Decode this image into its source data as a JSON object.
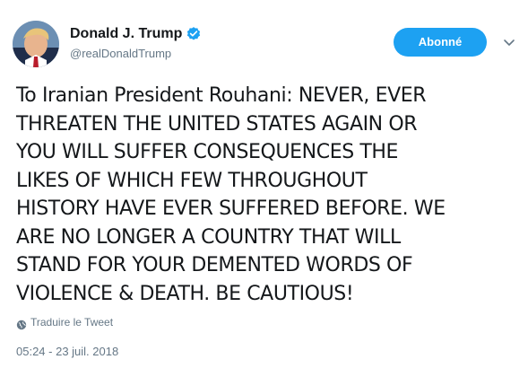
{
  "user": {
    "display_name": "Donald J. Trump",
    "handle": "@realDonaldTrump",
    "verified": true
  },
  "header": {
    "follow_label": "Abonné"
  },
  "tweet": {
    "text": "To Iranian President Rouhani: NEVER, EVER\nTHREATEN THE UNITED STATES AGAIN OR\nYOU WILL SUFFER CONSEQUENCES THE\nLIKES OF WHICH FEW THROUGHOUT\nHISTORY HAVE EVER SUFFERED BEFORE. WE\nARE NO LONGER A COUNTRY THAT WILL\nSTAND FOR YOUR DEMENTED WORDS OF\nVIOLENCE & DEATH. BE CAUTIOUS!",
    "translate_label": "Traduire le Tweet",
    "timestamp": "05:24 - 23 juil. 2018"
  },
  "icons": {
    "verified": "verified-badge-icon",
    "menu": "chevron-down-icon",
    "translate": "globe-icon"
  },
  "colors": {
    "accent": "#1da1f2",
    "text_primary": "#14171a",
    "text_secondary": "#657786"
  }
}
